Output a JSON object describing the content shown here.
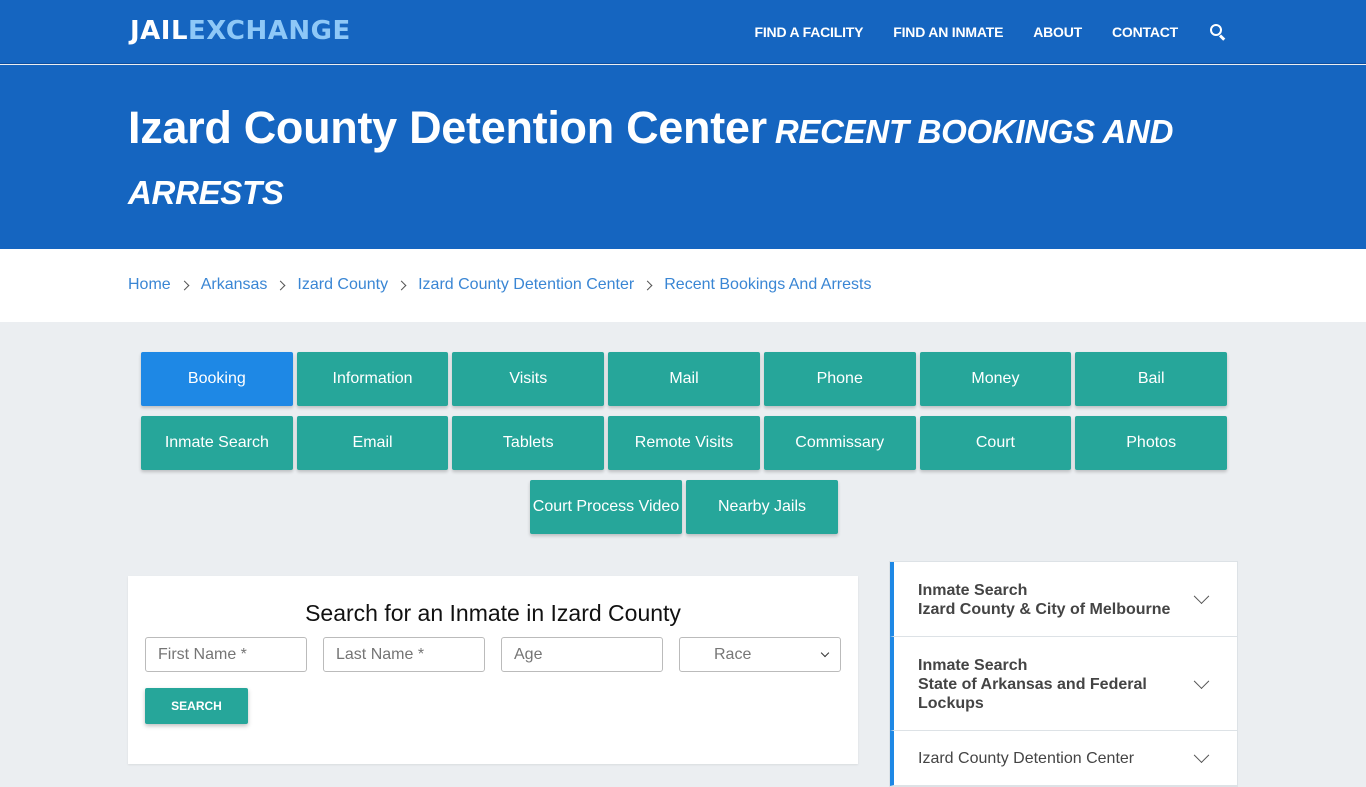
{
  "header": {
    "logo_part1": "JAIL",
    "logo_part2": "EXCHANGE",
    "nav": [
      "FIND A FACILITY",
      "FIND AN INMATE",
      "ABOUT",
      "CONTACT"
    ],
    "search_icon": "search-icon"
  },
  "hero": {
    "title": "Izard County Detention Center",
    "subtitle": "Recent Bookings And Arrests"
  },
  "breadcrumb": [
    "Home",
    "Arkansas",
    "Izard County",
    "Izard County Detention Center",
    "Recent Bookings And Arrests"
  ],
  "tabs": {
    "row1": [
      "Booking",
      "Information",
      "Visits",
      "Mail",
      "Phone",
      "Money",
      "Bail"
    ],
    "row2": [
      "Inmate Search",
      "Email",
      "Tablets",
      "Remote Visits",
      "Commissary",
      "Court",
      "Photos"
    ],
    "row3": [
      "Court Process Video",
      "Nearby Jails"
    ],
    "active": "Booking",
    "colors": {
      "active": "#1e88e5",
      "default": "#26a69a"
    }
  },
  "search": {
    "title": "Search for an Inmate in Izard County",
    "first_name_placeholder": "First Name *",
    "last_name_placeholder": "Last Name *",
    "age_placeholder": "Age",
    "race_selected": "Race",
    "button": "SEARCH"
  },
  "sidebar": {
    "items": [
      {
        "line1": "Inmate Search",
        "line2": "Izard County & City of Melbourne"
      },
      {
        "line1": "Inmate Search",
        "line2": "State of Arkansas and Federal Lockups"
      },
      {
        "line1": "Izard County Detention Center",
        "line2": ""
      }
    ]
  }
}
